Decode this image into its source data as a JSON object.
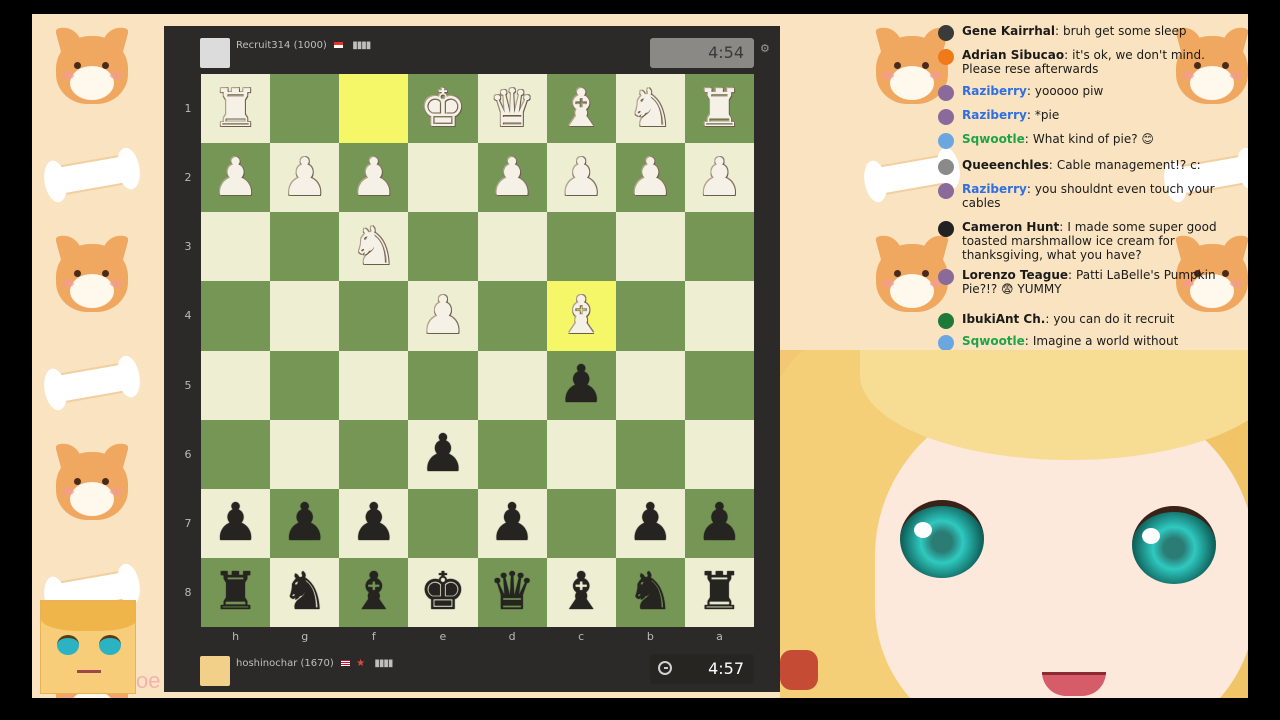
{
  "top_player": {
    "name": "Recruit314",
    "rating": "(1000)",
    "bars": "▮▮▮▮",
    "clock": "4:54"
  },
  "bottom_player": {
    "name": "hoshinochar",
    "rating": "(1670)",
    "bars": "▮▮▮▮",
    "clock": "4:57"
  },
  "board": {
    "orientation": "black-bottom",
    "ranks": [
      "1",
      "2",
      "3",
      "4",
      "5",
      "6",
      "7",
      "8"
    ],
    "files": [
      "h",
      "g",
      "f",
      "e",
      "d",
      "c",
      "b",
      "a"
    ],
    "rows": [
      [
        "wR",
        "",
        "",
        "wK",
        "wQ",
        "wB",
        "wN",
        "wR"
      ],
      [
        "wP",
        "wP",
        "wP",
        "",
        "wP",
        "wP",
        "wP",
        "wP"
      ],
      [
        "",
        "",
        "wN",
        "",
        "",
        "",
        "",
        ""
      ],
      [
        "",
        "",
        "",
        "wP",
        "",
        "wB",
        "",
        ""
      ],
      [
        "",
        "",
        "",
        "",
        "",
        "bP",
        "",
        ""
      ],
      [
        "",
        "",
        "",
        "bP",
        "",
        "",
        "",
        ""
      ],
      [
        "bP",
        "bP",
        "bP",
        "",
        "bP",
        "",
        "bP",
        "bP"
      ],
      [
        "bR",
        "bN",
        "bB",
        "bK",
        "bQ",
        "bB",
        "bN",
        "bR"
      ]
    ],
    "last_move": [
      "f1",
      "c4"
    ],
    "colors": {
      "light": "#eeeed2",
      "dark": "#769656",
      "highlight": "#f6f669"
    }
  },
  "chat": [
    {
      "user": "Gene Kairrhal",
      "text": "bruh get some sleep",
      "user_color": "#1b1b1b",
      "icon_color": "#3a3a3a"
    },
    {
      "user": "Adrian Sibucao",
      "text": "it's ok, we don't mind. Please rese afterwards",
      "user_color": "#1b1b1b",
      "icon_color": "#f07a1a"
    },
    {
      "user": "Raziberry",
      "text": "yooooo piw",
      "user_color": "#2f6fe0",
      "icon_color": "#8a6a9a"
    },
    {
      "user": "Raziberry",
      "text": "*pie",
      "user_color": "#2f6fe0",
      "icon_color": "#8a6a9a"
    },
    {
      "user": "Sqwootle",
      "text": "What kind of pie? 😊",
      "user_color": "#1fa34a",
      "icon_color": "#6aa7e0"
    },
    {
      "user": "Queeenchles",
      "text": "Cable management!? c:",
      "user_color": "#1b1b1b",
      "icon_color": "#8a8a8a"
    },
    {
      "user": "Raziberry",
      "text": "you shouldnt even touch your cables",
      "user_color": "#2f6fe0",
      "icon_color": "#8a6a9a"
    },
    {
      "user": "Cameron Hunt",
      "text": "I made some super good toasted marshmallow ice cream for thanksgiving, what you have?",
      "user_color": "#1b1b1b",
      "icon_color": "#222222"
    },
    {
      "user": "Lorenzo Teague",
      "text": "Patti LaBelle's Pumpkin Pie?!? 😨 YUMMY",
      "user_color": "#1b1b1b",
      "icon_color": "#8a6a9a"
    },
    {
      "user": "IbukiAnt Ch.",
      "text": "you can do it recruit",
      "user_color": "#1b1b1b",
      "icon_color": "#1f7a3a"
    },
    {
      "user": "Sqwootle",
      "text": "Imagine a world without",
      "user_color": "#1fa34a",
      "icon_color": "#6aa7e0"
    }
  ],
  "corner_caption": "oe"
}
